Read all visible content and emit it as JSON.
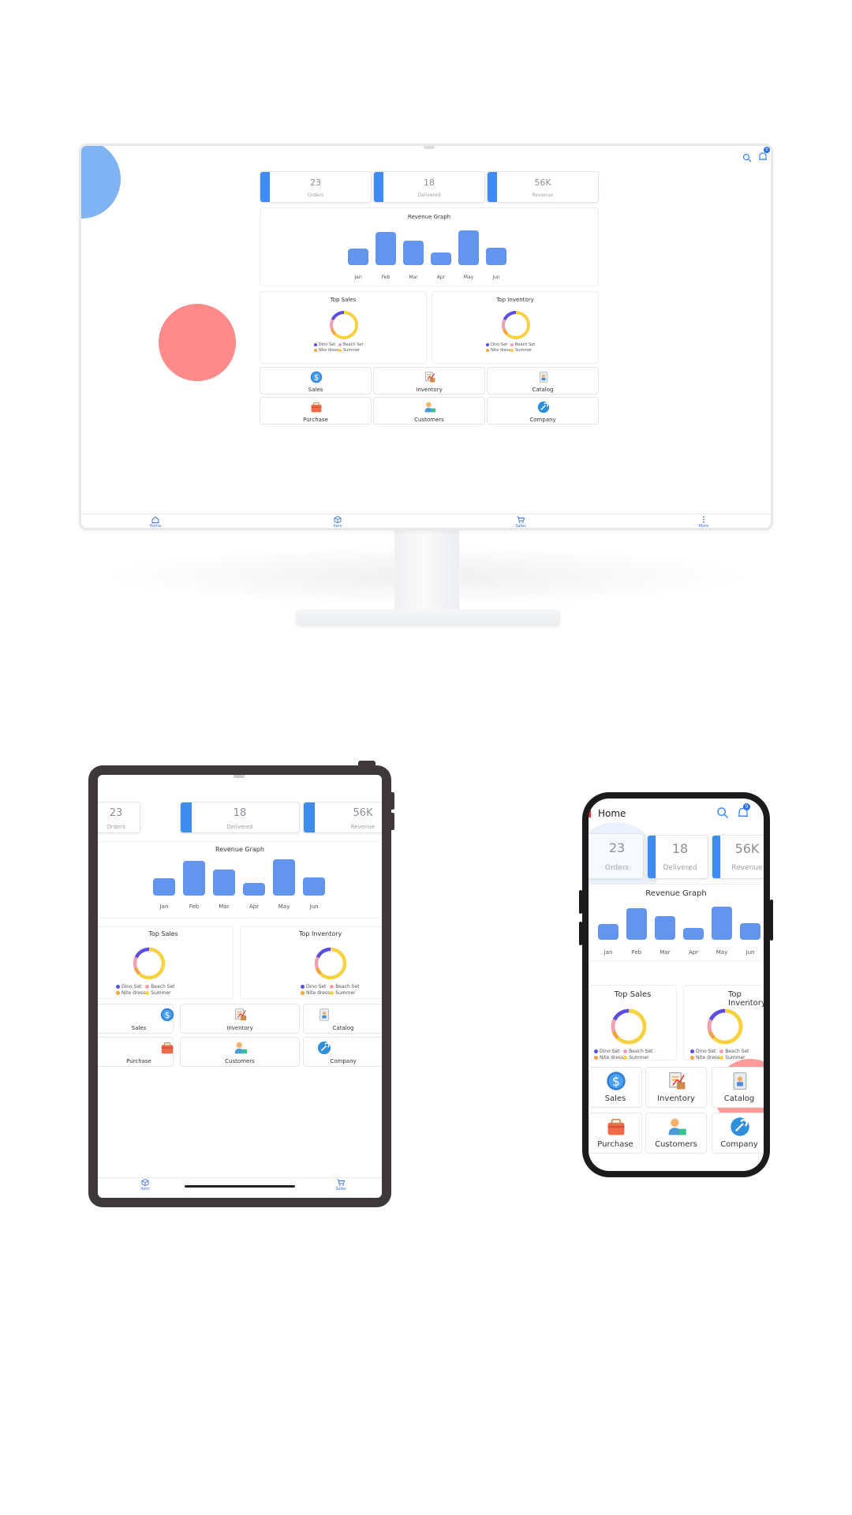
{
  "header": {
    "title": "Home",
    "notification_count": "0"
  },
  "stats": [
    {
      "value": "23",
      "label": "Orders"
    },
    {
      "value": "18",
      "label": "Delivered"
    },
    {
      "value": "56K",
      "label": "Revenue"
    }
  ],
  "revenue_title": "Revenue Graph",
  "chart_data": {
    "type": "bar",
    "title": "Revenue Graph",
    "categories": [
      "Jan",
      "Feb",
      "Mar",
      "Apr",
      "May",
      "Jun"
    ],
    "values": [
      2,
      4,
      3,
      1.5,
      4.2,
      2.1
    ]
  },
  "top_sales": {
    "title": "Top Sales",
    "legend": [
      "Dino Set",
      "Beach Set",
      "Nite dress",
      "Summer"
    ]
  },
  "top_inventory": {
    "title": "Top Inventory",
    "legend": [
      "Dino Set",
      "Beach Set",
      "Nite dress",
      "Summer"
    ]
  },
  "tiles": [
    "Sales",
    "Inventory",
    "Catalog",
    "Purchase",
    "Customers",
    "Company"
  ],
  "bottom_nav": [
    "Home",
    "Item",
    "Sales",
    "More"
  ],
  "colors": {
    "accent": "#3e8cf0",
    "bar": "#6395ef",
    "ring_yellow": "#f7d23e",
    "ring_blue": "#5b4fe0",
    "ring_pink": "#f0a0b0",
    "ring_orange": "#f4a340"
  }
}
